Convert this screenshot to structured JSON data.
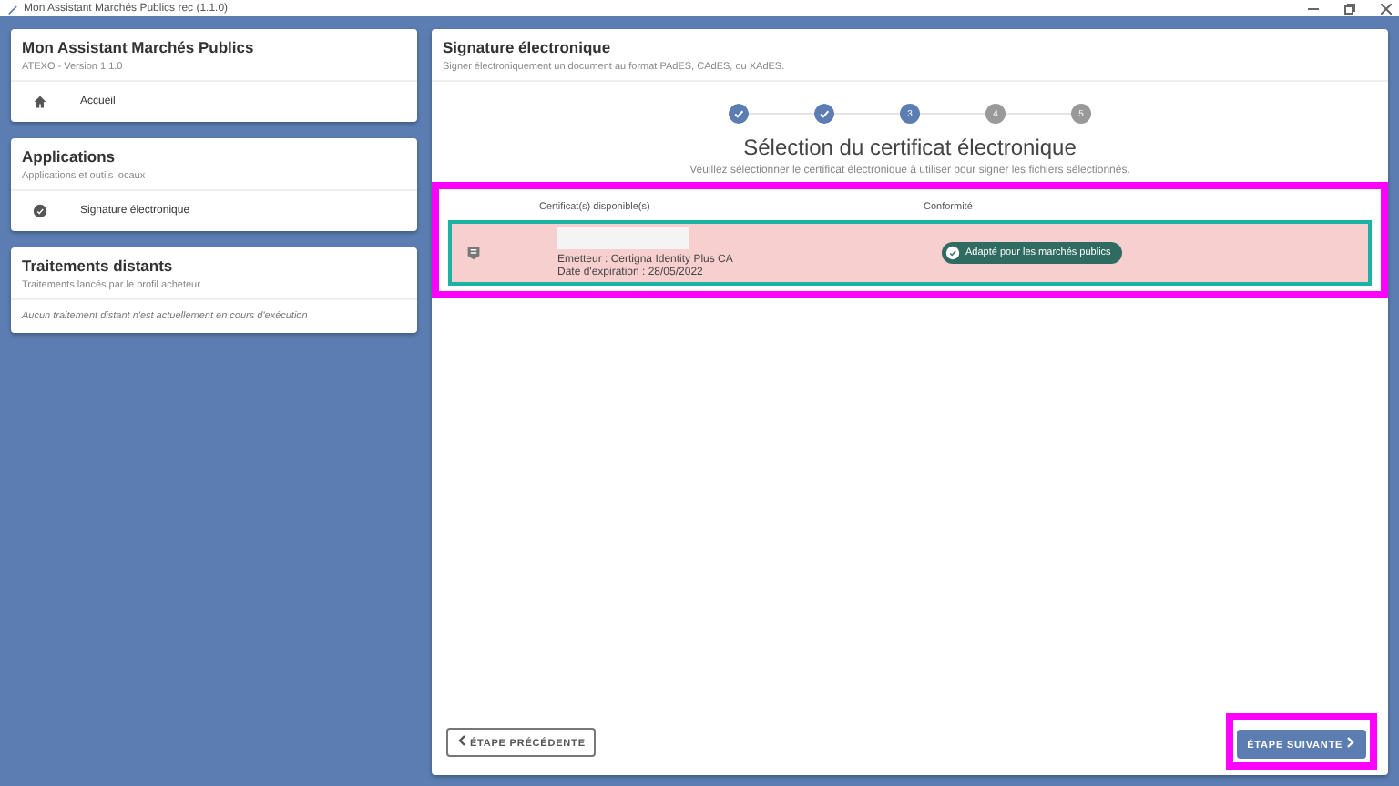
{
  "window": {
    "title": "Mon Assistant Marchés Publics rec (1.1.0)"
  },
  "sidebar": [
    {
      "title": "Mon Assistant Marchés Publics",
      "subtitle": "ATEXO - Version 1.1.0",
      "items": [
        {
          "kind": "home",
          "label": "Accueil"
        }
      ]
    },
    {
      "title": "Applications",
      "subtitle": "Applications et outils locaux",
      "items": [
        {
          "kind": "check",
          "label": "Signature électronique"
        }
      ]
    },
    {
      "title": "Traitements distants",
      "subtitle": "Traitements lancés par le profil acheteur",
      "note": "Aucun traitement distant n'est actuellement en cours d'exécution"
    }
  ],
  "panel": {
    "title": "Signature électronique",
    "subtitle": "Signer électroniquement un document au format PAdES, CAdES, ou XAdES.",
    "steps": [
      {
        "completed": true,
        "selected": false
      },
      {
        "completed": true,
        "selected": false
      },
      {
        "completed": false,
        "selected": true,
        "label": "3"
      },
      {
        "completed": false,
        "selected": false,
        "label": "4"
      },
      {
        "completed": false,
        "selected": false,
        "label": "5"
      }
    ],
    "heading": "Sélection du certificat électronique",
    "instruction": "Veuillez sélectionner le certificat électronique à utiliser pour signer les fichiers sélectionnés.",
    "table": {
      "highlighted": true,
      "columns": [
        "Certificat(s) disponible(s)",
        "Conformité"
      ],
      "rows": [
        {
          "selected": true,
          "issuer": "Emetteur : Certigna Identity Plus CA",
          "expiry": "Date d'expiration : 28/05/2022",
          "conformity": "Adapté pour les marchés publics"
        }
      ]
    },
    "back_button": "ÉTAPE PRÉCÉDENTE",
    "next_button": {
      "label": "ÉTAPE SUIVANTE",
      "highlighted": true
    }
  }
}
